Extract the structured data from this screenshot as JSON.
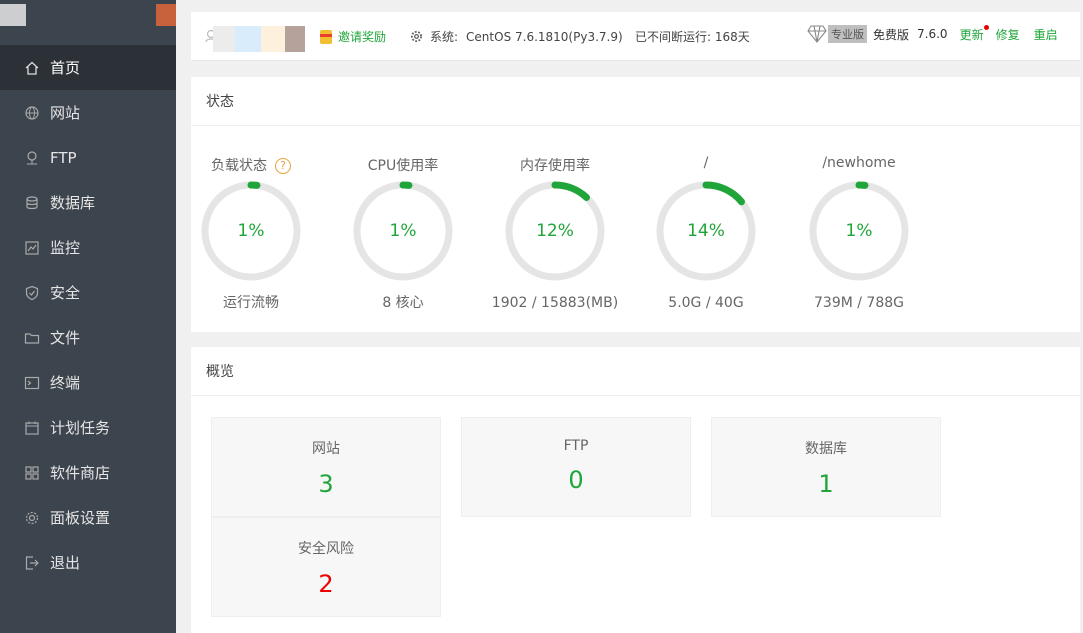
{
  "sidebar": {
    "items": [
      {
        "label": "首页",
        "icon": "home-icon"
      },
      {
        "label": "网站",
        "icon": "globe-icon"
      },
      {
        "label": "FTP",
        "icon": "ftp-icon"
      },
      {
        "label": "数据库",
        "icon": "database-icon"
      },
      {
        "label": "监控",
        "icon": "monitor-icon"
      },
      {
        "label": "安全",
        "icon": "shield-icon"
      },
      {
        "label": "文件",
        "icon": "folder-icon"
      },
      {
        "label": "终端",
        "icon": "terminal-icon"
      },
      {
        "label": "计划任务",
        "icon": "calendar-icon"
      },
      {
        "label": "软件商店",
        "icon": "grid-icon"
      },
      {
        "label": "面板设置",
        "icon": "gear-icon"
      },
      {
        "label": "退出",
        "icon": "logout-icon"
      }
    ]
  },
  "header": {
    "invite_label": "邀请奖励",
    "system_label": "系统:",
    "system_value": "CentOS 7.6.1810(Py3.7.9)",
    "uptime": "已不间断运行: 168天",
    "pro_label": "专业版",
    "free_label": "免费版",
    "version": "7.6.0",
    "update_label": "更新",
    "repair_label": "修复",
    "restart_label": "重启"
  },
  "status": {
    "title": "状态",
    "gauges": [
      {
        "title": "负载状态",
        "value": "1%",
        "percent": 1,
        "sub": "运行流畅",
        "help": "?"
      },
      {
        "title": "CPU使用率",
        "value": "1%",
        "percent": 1,
        "sub": "8 核心"
      },
      {
        "title": "内存使用率",
        "value": "12%",
        "percent": 12,
        "sub": "1902 / 15883(MB)"
      },
      {
        "title": "/",
        "value": "14%",
        "percent": 14,
        "sub": "5.0G / 40G"
      },
      {
        "title": "/newhome",
        "value": "1%",
        "percent": 1,
        "sub": "739M / 788G"
      }
    ]
  },
  "overview": {
    "title": "概览",
    "cards": [
      {
        "label": "网站",
        "value": "3"
      },
      {
        "label": "FTP",
        "value": "0"
      },
      {
        "label": "数据库",
        "value": "1"
      },
      {
        "label": "安全风险",
        "value": "2"
      }
    ]
  },
  "colors": {
    "accent": "#20a53a",
    "danger": "#ee0000",
    "sidebar": "#3c444d",
    "track": "#e5e5e5"
  }
}
